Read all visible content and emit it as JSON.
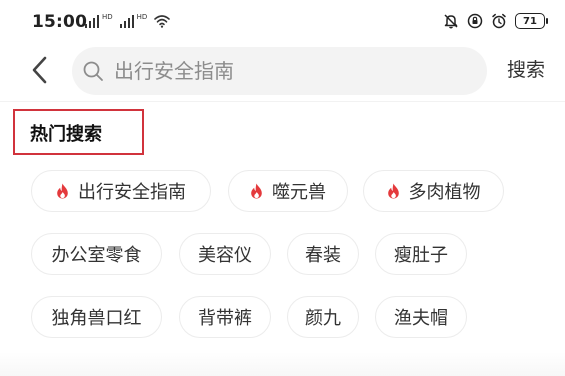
{
  "status_bar": {
    "time": "15:00",
    "signal_tag": "HD",
    "battery": "71",
    "icons": [
      "signal-icon",
      "signal-icon",
      "wifi-icon",
      "bell-off-icon",
      "rotation-lock-icon",
      "alarm-icon",
      "battery-icon"
    ]
  },
  "search": {
    "back_icon": "chevron-left-icon",
    "icon": "search-icon",
    "placeholder": "出行安全指南",
    "button_label": "搜索"
  },
  "hot_search": {
    "title": "热门搜索",
    "highlight_color": "#d1333c",
    "flame_color": "#e4393c",
    "items": [
      {
        "label": "出行安全指南",
        "hot": true
      },
      {
        "label": "噬元兽",
        "hot": true
      },
      {
        "label": "多肉植物",
        "hot": true
      },
      {
        "label": "办公室零食",
        "hot": false
      },
      {
        "label": "美容仪",
        "hot": false
      },
      {
        "label": "春装",
        "hot": false
      },
      {
        "label": "瘦肚子",
        "hot": false
      },
      {
        "label": "独角兽口红",
        "hot": false
      },
      {
        "label": "背带裤",
        "hot": false
      },
      {
        "label": "颜九",
        "hot": false
      },
      {
        "label": "渔夫帽",
        "hot": false
      }
    ]
  }
}
